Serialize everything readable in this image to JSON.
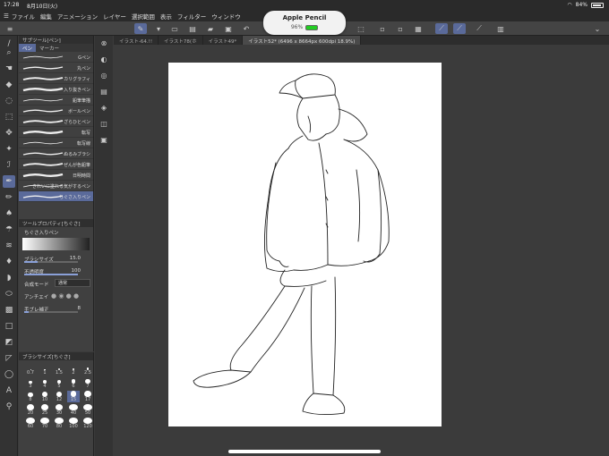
{
  "status": {
    "time": "17:28",
    "date": "8月10日(火)",
    "battery": "84%"
  },
  "menu": [
    "ファイル",
    "編集",
    "アニメーション",
    "レイヤー",
    "選択範囲",
    "表示",
    "フィルター",
    "ウィンドウ"
  ],
  "pencil": {
    "title": "Apple Pencil",
    "percent": "96%"
  },
  "subtool": {
    "header": "サブツール[ペン]",
    "tabs": [
      "ペン",
      "マーカー"
    ],
    "brushes": [
      "Gペン",
      "丸ペン",
      "カリグラフィ",
      "入り抜きペン",
      "鉛筆筆描",
      "ボールペン",
      "ざらひとペン",
      "転写",
      "転写線",
      "ぬるみブラシ",
      "ぜんが色鉛筆",
      "日明時間",
      "きれいに塗れる気がするペン",
      "ちぐさ入りペン"
    ]
  },
  "toolprop": {
    "header": "ツールプロパティ[ちぐさ]",
    "preset_name": "ちぐさ入りペン",
    "brush_size_label": "ブラシサイズ",
    "brush_size_value": "15.0",
    "brush_size_level": 0.25,
    "opacity_label": "不透明度",
    "opacity_value": "100",
    "opacity_level": 1.0,
    "blend_label": "合成モード",
    "blend_value": "通常",
    "aa_label": "アンチエイ",
    "stab_label": "手ブレ補正",
    "stab_value": "8",
    "stab_level": 0.08
  },
  "sizepalette": {
    "header": "ブラシサイズ[ちぐさ]",
    "sizes": [
      "0.7",
      "1",
      "1.5",
      "2",
      "2.5",
      "3",
      "4",
      "5",
      "6",
      "7",
      "8",
      "10",
      "12",
      "15",
      "17",
      "20",
      "25",
      "30",
      "40",
      "50",
      "60",
      "70",
      "80",
      "100",
      "120"
    ],
    "selected": "15"
  },
  "doctabs": [
    "イラスト-64.!!",
    "イラスト78(ホ",
    "イラスト49*",
    "イラスト52* (6496 x 8664px 600dpi 18.9%)"
  ]
}
